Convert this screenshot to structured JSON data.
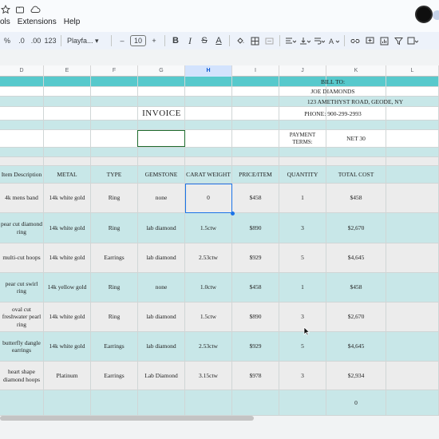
{
  "menus": [
    "ols",
    "Extensions",
    "Help"
  ],
  "toolbar": {
    "percent": "%",
    "dec_less": ".0",
    "dec_more": ".00",
    "format_123": "123",
    "font": "Playfa...",
    "minus": "–",
    "size": "10",
    "plus": "+",
    "bold": "B",
    "italic": "I",
    "strike": "S",
    "underline": "A"
  },
  "colors": {
    "teal": "#57c9cc",
    "light_teal": "#c8e7e8",
    "selection": "#1a73e8"
  },
  "columns": [
    "D",
    "E",
    "F",
    "G",
    "H",
    "I",
    "J",
    "K",
    "L"
  ],
  "header_block": {
    "bill_to": "BILL TO:",
    "name": "JOE DIAMONDS",
    "address": "123 AMETHYST ROAD, GEODE, NY",
    "phone": "PHONE: 900-299-2993",
    "invoice": "INVOICE",
    "payment_terms": "PAYMENT TERMS:",
    "net": "NET 30"
  },
  "table_headers": [
    "Item Description",
    "METAL",
    "TYPE",
    "GEMSTONE",
    "CARAT WEIGHT",
    "PRICE/ITEM",
    "QUANTITY",
    "TOTAL COST"
  ],
  "rows": [
    [
      "4k mens band",
      "14k white gold",
      "Ring",
      "none",
      "0",
      "$458",
      "1",
      "$458"
    ],
    [
      "pear cut diamond ring",
      "14k white gold",
      "Ring",
      "lab diamond",
      "1.5ctw",
      "$890",
      "3",
      "$2,670"
    ],
    [
      "multi-cut hoops",
      "14k white gold",
      "Earrings",
      "lab diamond",
      "2.53ctw",
      "$929",
      "5",
      "$4,645"
    ],
    [
      "pear cut swirl ring",
      "14k yellow gold",
      "Ring",
      "none",
      "1.0ctw",
      "$458",
      "1",
      "$458"
    ],
    [
      "oval cut freshwater pearl ring",
      "14k white gold",
      "Ring",
      "lab diamond",
      "1.5ctw",
      "$890",
      "3",
      "$2,670"
    ],
    [
      "butterfly dangle earrings",
      "14k white gold",
      "Earrings",
      "lab diamond",
      "2.53ctw",
      "$929",
      "5",
      "$4,645"
    ],
    [
      "heart shape diamond hoops",
      "Platinum",
      "Earrings",
      "Lab Diamond",
      "3.15ctw",
      "$978",
      "3",
      "$2,934"
    ]
  ],
  "total": "0"
}
